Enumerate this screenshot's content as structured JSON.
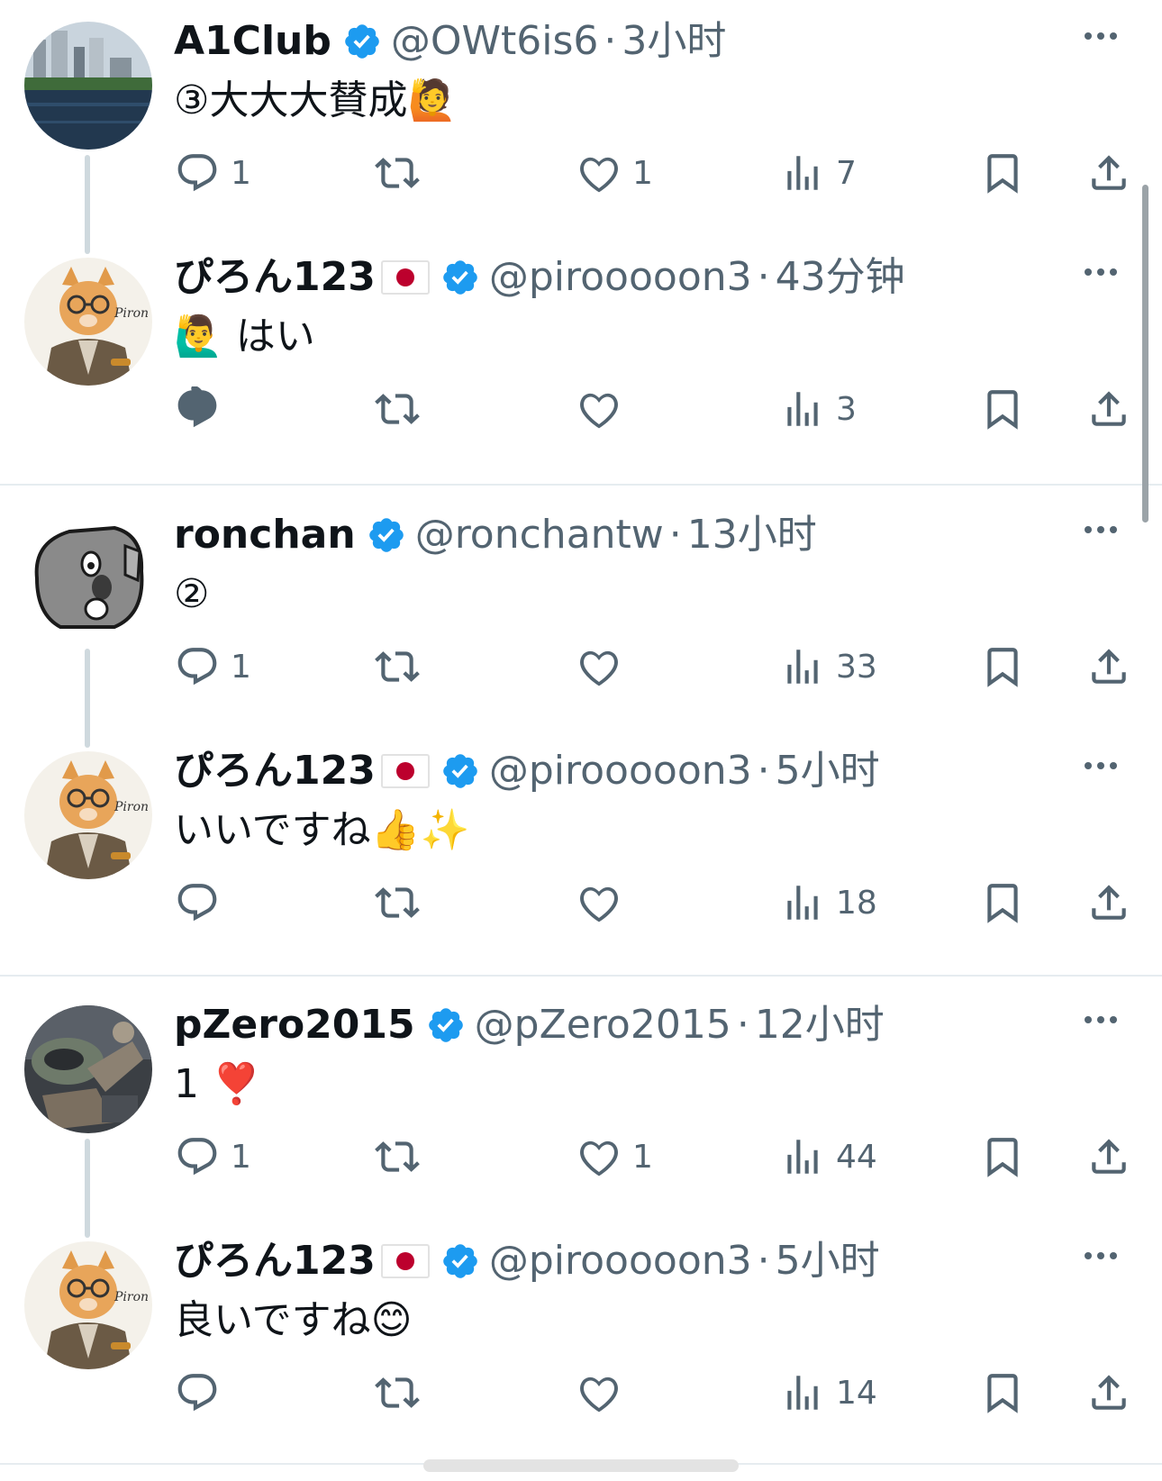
{
  "tweets": [
    {
      "name": "A1Club",
      "flag": false,
      "handle": "@OWt6is6",
      "sep": "·",
      "time": "3小时",
      "text": "③大大大賛成🙋",
      "replies": "1",
      "retweets": "",
      "likes": "1",
      "views": "7",
      "avatar": "city-river-avatar"
    },
    {
      "name": "ぴろん123",
      "flag": true,
      "handle": "@pirooooon3",
      "sep": "·",
      "time": "43分钟",
      "text": "🙋‍♂️ はい",
      "replies": "",
      "retweets": "",
      "likes": "",
      "views": "3",
      "avatar": "cat-samurai-avatar"
    },
    {
      "name": "ronchan",
      "flag": false,
      "handle": "@ronchantw",
      "sep": "·",
      "time": "13小时",
      "text": "②",
      "replies": "1",
      "retweets": "",
      "likes": "",
      "views": "33",
      "avatar": "koala-pixel-avatar"
    },
    {
      "name": "ぴろん123",
      "flag": true,
      "handle": "@pirooooon3",
      "sep": "·",
      "time": "5小时",
      "text": "いいですね👍✨",
      "replies": "",
      "retweets": "",
      "likes": "",
      "views": "18",
      "avatar": "cat-samurai-avatar"
    },
    {
      "name": "pZero2015",
      "flag": false,
      "handle": "@pZero2015",
      "sep": "·",
      "time": "12小时",
      "text": "1 ❣️",
      "replies": "1",
      "retweets": "",
      "likes": "1",
      "views": "44",
      "avatar": "robot-scene-avatar"
    },
    {
      "name": "ぴろん123",
      "flag": true,
      "handle": "@pirooooon3",
      "sep": "·",
      "time": "5小时",
      "text": "良いですね😊",
      "replies": "",
      "retweets": "",
      "likes": "",
      "views": "14",
      "avatar": "cat-samurai-avatar"
    }
  ],
  "colors": {
    "verified": "#1d9bf0",
    "text": "#0f1419",
    "secondary": "#536471",
    "divider": "#e6ecf0",
    "thread_line": "#cfd9de"
  },
  "icons": [
    "reply-icon",
    "retweet-icon",
    "like-icon",
    "views-icon",
    "bookmark-icon",
    "share-icon",
    "more-icon",
    "verified-badge-icon",
    "japan-flag-icon"
  ]
}
